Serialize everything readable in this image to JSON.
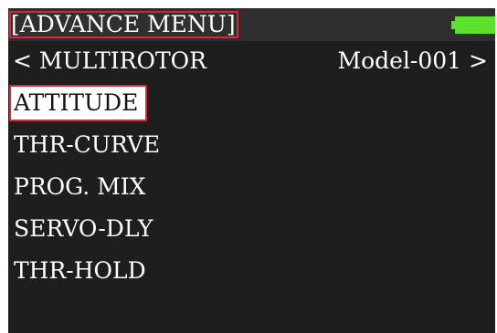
{
  "header": {
    "title": "[ADVANCE MENU]",
    "battery_icon": "battery-full-icon",
    "battery_level": 1.0,
    "battery_color": "#5de22c"
  },
  "nav": {
    "prev_symbol": "<",
    "model_type": "MULTIROTOR",
    "model_name": "Model-001",
    "next_symbol": ">"
  },
  "menu": {
    "selected_index": 0,
    "items": [
      {
        "label": "ATTITUDE"
      },
      {
        "label": "THR-CURVE"
      },
      {
        "label": "PROG. MIX"
      },
      {
        "label": "SERVO-DLY"
      },
      {
        "label": "THR-HOLD"
      }
    ]
  },
  "colors": {
    "screen_bg": "#1e1e1e",
    "title_bar_bg": "#2f2f2f",
    "highlight_bg": "#ffffff",
    "focus_outline": "#d8263a"
  }
}
